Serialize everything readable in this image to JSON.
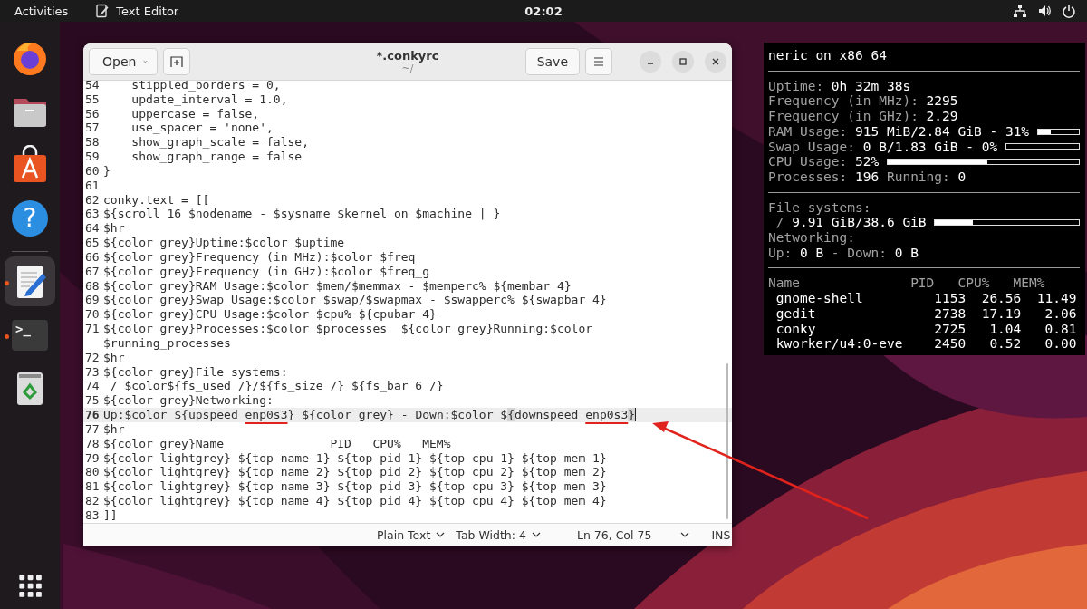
{
  "top_bar": {
    "activities": "Activities",
    "app_menu": "Text Editor",
    "clock": "02:02"
  },
  "dock": {
    "items": [
      {
        "kind": "browser",
        "running": false,
        "selected": false
      },
      {
        "kind": "files",
        "running": false,
        "selected": false
      },
      {
        "kind": "store",
        "running": false,
        "selected": false
      },
      {
        "kind": "help",
        "glyph": "?",
        "running": false,
        "selected": false
      },
      {
        "kind": "separator"
      },
      {
        "kind": "editor",
        "running": true,
        "selected": true
      },
      {
        "kind": "terminal",
        "glyph": ">_",
        "running": true,
        "selected": false
      },
      {
        "kind": "trash",
        "running": false,
        "selected": false
      }
    ]
  },
  "editor": {
    "open_button": "Open",
    "title": "*.conkyrc",
    "subtitle": "~/",
    "save_button": "Save",
    "lines": [
      {
        "number": "54",
        "text": "    stippled_borders = 0,",
        "current": false
      },
      {
        "number": "55",
        "text": "    update_interval = 1.0,",
        "current": false
      },
      {
        "number": "56",
        "text": "    uppercase = false,",
        "current": false
      },
      {
        "number": "57",
        "text": "    use_spacer = 'none',",
        "current": false
      },
      {
        "number": "58",
        "text": "    show_graph_scale = false,",
        "current": false
      },
      {
        "number": "59",
        "text": "    show_graph_range = false",
        "current": false
      },
      {
        "number": "60",
        "text": "}",
        "current": false
      },
      {
        "number": "61",
        "current": false
      },
      {
        "number": "62",
        "text": "conky.text = [[",
        "current": false
      },
      {
        "number": "63",
        "text": "${scroll 16 $nodename - $sysname $kernel on $machine | }",
        "current": false
      },
      {
        "number": "64",
        "text": "$hr",
        "current": false
      },
      {
        "number": "65",
        "text": "${color grey}Uptime:$color $uptime",
        "current": false
      },
      {
        "number": "66",
        "text": "${color grey}Frequency (in MHz):$color $freq",
        "current": false
      },
      {
        "number": "67",
        "text": "${color grey}Frequency (in GHz):$color $freq_g",
        "current": false
      },
      {
        "number": "68",
        "text": "${color grey}RAM Usage:$color $mem/$memmax - $memperc% ${membar 4}",
        "current": false
      },
      {
        "number": "69",
        "text": "${color grey}Swap Usage:$color $swap/$swapmax - $swapperc% ${swapbar 4}",
        "current": false
      },
      {
        "number": "70",
        "text": "${color grey}CPU Usage:$color $cpu% ${cpubar 4}",
        "current": false
      },
      {
        "number": "71",
        "text": "${color grey}Processes:$color $processes  ${color grey}Running:$color",
        "continuation": "$running_processes",
        "current": false
      },
      {
        "number": "72",
        "text": "$hr",
        "current": false
      },
      {
        "number": "73",
        "text": "${color grey}File systems:",
        "current": false
      },
      {
        "number": "74",
        "text": " / $color${fs_used /}/${fs_size /} ${fs_bar 6 /}",
        "current": false
      },
      {
        "number": "75",
        "text": "${color grey}Networking:",
        "current": false
      },
      {
        "number": "76",
        "current": true,
        "parts": [
          {
            "kind": "plain",
            "text": "Up:$color ${upspeed "
          },
          {
            "kind": "underlined",
            "text": "enp0s3"
          },
          {
            "kind": "plain",
            "text": "} ${color grey} - Down:$color $"
          },
          {
            "kind": "bracket",
            "text": "{"
          },
          {
            "kind": "plain",
            "text": "downspeed "
          },
          {
            "kind": "underlined",
            "text": "enp0s3"
          },
          {
            "kind": "bracket",
            "text": "}"
          }
        ]
      },
      {
        "number": "77",
        "text": "$hr",
        "current": false
      },
      {
        "number": "78",
        "text": "${color grey}Name               PID   CPU%   MEM%",
        "current": false
      },
      {
        "number": "79",
        "text": "${color lightgrey} ${top name 1} ${top pid 1} ${top cpu 1} ${top mem 1}",
        "current": false
      },
      {
        "number": "80",
        "text": "${color lightgrey} ${top name 2} ${top pid 2} ${top cpu 2} ${top mem 2}",
        "current": false
      },
      {
        "number": "81",
        "text": "${color lightgrey} ${top name 3} ${top pid 3} ${top cpu 3} ${top mem 3}",
        "current": false
      },
      {
        "number": "82",
        "text": "${color lightgrey} ${top name 4} ${top pid 4} ${top cpu 4} ${top mem 4}",
        "current": false
      },
      {
        "number": "83",
        "text": "]]",
        "current": false
      }
    ],
    "status_bar": {
      "language": "Plain Text",
      "tab_width": "Tab Width: 4",
      "position": "Ln 76, Col 75",
      "mode": "INS"
    }
  },
  "conky": {
    "rows": [
      {
        "kind": "text",
        "parts": [
          {
            "text": "neric on x86_64",
            "dim": false
          }
        ]
      },
      {
        "kind": "rule"
      },
      {
        "kind": "text",
        "parts": [
          {
            "text": "Uptime:",
            "dim": true
          },
          {
            "text": "0h 32m 38s",
            "dim": false
          }
        ]
      },
      {
        "kind": "text",
        "parts": [
          {
            "text": "Frequency (in MHz):",
            "dim": true
          },
          {
            "text": "2295",
            "dim": false
          }
        ]
      },
      {
        "kind": "text",
        "parts": [
          {
            "text": "Frequency (in GHz):",
            "dim": true
          },
          {
            "text": "2.29",
            "dim": false
          }
        ]
      },
      {
        "kind": "bar",
        "parts": [
          {
            "text": "RAM Usage:",
            "dim": true
          },
          {
            "text": "915 MiB/2.84 GiB - 31%",
            "dim": false
          }
        ],
        "level": 0.31
      },
      {
        "kind": "bar",
        "parts": [
          {
            "text": "Swap Usage:",
            "dim": true
          },
          {
            "text": "0 B/1.83 GiB - 0%",
            "dim": false
          }
        ],
        "level": 0
      },
      {
        "kind": "bar",
        "parts": [
          {
            "text": "CPU Usage:",
            "dim": true
          },
          {
            "text": "52%",
            "dim": false
          }
        ],
        "level": 0.52
      },
      {
        "kind": "text",
        "parts": [
          {
            "text": "Processes:",
            "dim": true
          },
          {
            "text": "196",
            "dim": false
          },
          {
            "text": "Running:",
            "dim": true
          },
          {
            "text": "0",
            "dim": false
          }
        ]
      },
      {
        "kind": "rule"
      },
      {
        "kind": "text",
        "parts": [
          {
            "text": "File systems:",
            "dim": true
          }
        ]
      },
      {
        "kind": "bar",
        "indent": true,
        "parts": [
          {
            "text": "/",
            "dim": true
          },
          {
            "text": "9.91 GiB/38.6 GiB",
            "dim": false
          }
        ],
        "level": 0.26
      },
      {
        "kind": "text",
        "parts": [
          {
            "text": "Networking:",
            "dim": true
          }
        ]
      },
      {
        "kind": "text",
        "parts": [
          {
            "text": "Up:",
            "dim": true
          },
          {
            "text": "0 B",
            "dim": false
          },
          {
            "text": "- Down:",
            "dim": true
          },
          {
            "text": "0 B",
            "dim": false
          }
        ]
      },
      {
        "kind": "rule"
      }
    ],
    "processes": {
      "columns": [
        "Name",
        "PID",
        "CPU%",
        "MEM%"
      ],
      "rows": [
        {
          "name": "gnome-shell",
          "pid": "1153",
          "cpu": "26.56",
          "mem": "11.49"
        },
        {
          "name": "gedit",
          "pid": "2738",
          "cpu": "17.19",
          "mem": "2.06"
        },
        {
          "name": "conky",
          "pid": "2725",
          "cpu": "1.04",
          "mem": "0.81"
        },
        {
          "name": "kworker/u4:0-eve",
          "pid": "2450",
          "cpu": "0.52",
          "mem": "0.00"
        }
      ]
    }
  }
}
